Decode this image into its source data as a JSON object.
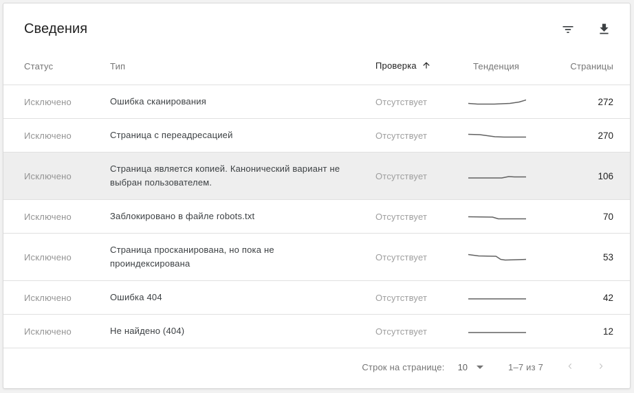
{
  "page": {
    "title": "Сведения"
  },
  "toolbar": {
    "icons": {
      "filter": "filter-list",
      "download": "file-download"
    }
  },
  "colors": {
    "sparkline": "#616161",
    "highlighted_row_bg": "#eeeeee",
    "separator": "#e0e0e0",
    "header_text": "#757575",
    "sorted_header_text": "#212121",
    "muted_text": "#9e9e9e",
    "body_text": "#3c4043"
  },
  "table": {
    "columns": [
      {
        "key": "status",
        "label": "Статус"
      },
      {
        "key": "type",
        "label": "Тип"
      },
      {
        "key": "verification",
        "label": "Проверка",
        "sorted": true,
        "sort_direction": "asc",
        "sort_icon": "arrow-up"
      },
      {
        "key": "trend",
        "label": "Тенденция"
      },
      {
        "key": "pages",
        "label": "Страницы"
      }
    ],
    "rows": [
      {
        "status": "Исключено",
        "type": "Ошибка сканирования",
        "verification": "Отсутствует",
        "pages": 272,
        "highlighted": false,
        "trend": [
          [
            0,
            9.5
          ],
          [
            16,
            10.5
          ],
          [
            45,
            10.5
          ],
          [
            72,
            9.5
          ],
          [
            88,
            7.5
          ],
          [
            100,
            4.5
          ]
        ]
      },
      {
        "status": "Исключено",
        "type": "Страница с переадресацией",
        "verification": "Отсутствует",
        "pages": 270,
        "highlighted": false,
        "trend": [
          [
            0,
            5.5
          ],
          [
            20,
            6
          ],
          [
            46,
            9
          ],
          [
            62,
            9.5
          ],
          [
            100,
            9.5
          ]
        ]
      },
      {
        "status": "Исключено",
        "type": "Страница является копией. Канонический вариант не выбран пользователем.",
        "verification": "Отсутствует",
        "pages": 106,
        "highlighted": true,
        "trend": [
          [
            0,
            10
          ],
          [
            58,
            10
          ],
          [
            70,
            8
          ],
          [
            80,
            8.5
          ],
          [
            100,
            8.5
          ]
        ]
      },
      {
        "status": "Исключено",
        "type": "Заблокировано в файле robots.txt",
        "verification": "Отсутствует",
        "pages": 70,
        "highlighted": false,
        "trend": [
          [
            0,
            7.5
          ],
          [
            42,
            8
          ],
          [
            52,
            10.5
          ],
          [
            100,
            10.5
          ]
        ]
      },
      {
        "status": "Исключено",
        "type": "Страница просканирована, но пока не проиндексирована",
        "verification": "Отсутствует",
        "pages": 53,
        "highlighted": false,
        "trend": [
          [
            0,
            3.5
          ],
          [
            18,
            5.5
          ],
          [
            48,
            6
          ],
          [
            56,
            10.5
          ],
          [
            64,
            11.5
          ],
          [
            100,
            10.5
          ]
        ]
      },
      {
        "status": "Исключено",
        "type": "Ошибка 404",
        "verification": "Отсутствует",
        "pages": 42,
        "highlighted": false,
        "trend": [
          [
            0,
            9
          ],
          [
            100,
            9
          ]
        ]
      },
      {
        "status": "Исключено",
        "type": "Не найдено (404)",
        "verification": "Отсутствует",
        "pages": 12,
        "highlighted": false,
        "trend": [
          [
            0,
            9
          ],
          [
            100,
            9
          ]
        ]
      }
    ]
  },
  "pagination": {
    "rows_per_page_label": "Строк на странице:",
    "rows_per_page_value": "10",
    "range_text": "1–7 из 7",
    "icons": {
      "select_caret": "caret-down",
      "prev": "chevron-left",
      "next": "chevron-right"
    }
  }
}
